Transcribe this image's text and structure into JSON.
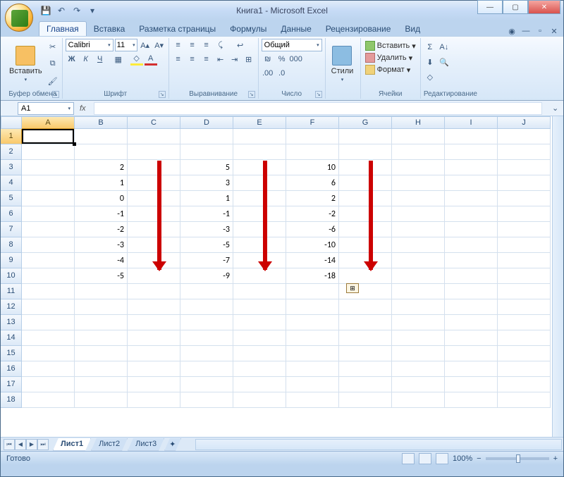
{
  "title": "Книга1 - Microsoft Excel",
  "quick_access": {
    "save": "💾",
    "undo": "↶",
    "redo": "↷"
  },
  "tabs": {
    "home": "Главная",
    "insert": "Вставка",
    "layout": "Разметка страницы",
    "formulas": "Формулы",
    "data": "Данные",
    "review": "Рецензирование",
    "view": "Вид"
  },
  "groups": {
    "clipboard": {
      "label": "Буфер обмена",
      "paste": "Вставить"
    },
    "font": {
      "label": "Шрифт",
      "name": "Calibri",
      "size": "11"
    },
    "alignment": {
      "label": "Выравнивание"
    },
    "number": {
      "label": "Число",
      "format": "Общий"
    },
    "styles": {
      "label": "Стили"
    },
    "cells": {
      "label": "Ячейки",
      "insert": "Вставить",
      "delete": "Удалить",
      "format": "Формат"
    },
    "editing": {
      "label": "Редактирование"
    }
  },
  "namebox": "A1",
  "fx": "fx",
  "columns": [
    "A",
    "B",
    "C",
    "D",
    "E",
    "F",
    "G",
    "H",
    "I",
    "J"
  ],
  "chart_data": {
    "type": "table",
    "columns_used": [
      "B",
      "D",
      "F"
    ],
    "rows_used": [
      3,
      4,
      5,
      6,
      7,
      8,
      9,
      10
    ],
    "series": [
      {
        "name": "B",
        "values": [
          2,
          1,
          0,
          -1,
          -2,
          -3,
          -4,
          -5
        ]
      },
      {
        "name": "D",
        "values": [
          5,
          3,
          1,
          -1,
          -3,
          -5,
          -7,
          -9
        ]
      },
      {
        "name": "F",
        "values": [
          10,
          6,
          2,
          -2,
          -6,
          -10,
          -14,
          -18
        ]
      }
    ]
  },
  "cells": {
    "r3": {
      "B": "2",
      "D": "5",
      "F": "10"
    },
    "r4": {
      "B": "1",
      "D": "3",
      "F": "6"
    },
    "r5": {
      "B": "0",
      "D": "1",
      "F": "2"
    },
    "r6": {
      "B": "-1",
      "D": "-1",
      "F": "-2"
    },
    "r7": {
      "B": "-2",
      "D": "-3",
      "F": "-6"
    },
    "r8": {
      "B": "-3",
      "D": "-5",
      "F": "-10"
    },
    "r9": {
      "B": "-4",
      "D": "-7",
      "F": "-14"
    },
    "r10": {
      "B": "-5",
      "D": "-9",
      "F": "-18"
    }
  },
  "sheets": {
    "s1": "Лист1",
    "s2": "Лист2",
    "s3": "Лист3"
  },
  "status": {
    "ready": "Готово",
    "zoom": "100%"
  }
}
